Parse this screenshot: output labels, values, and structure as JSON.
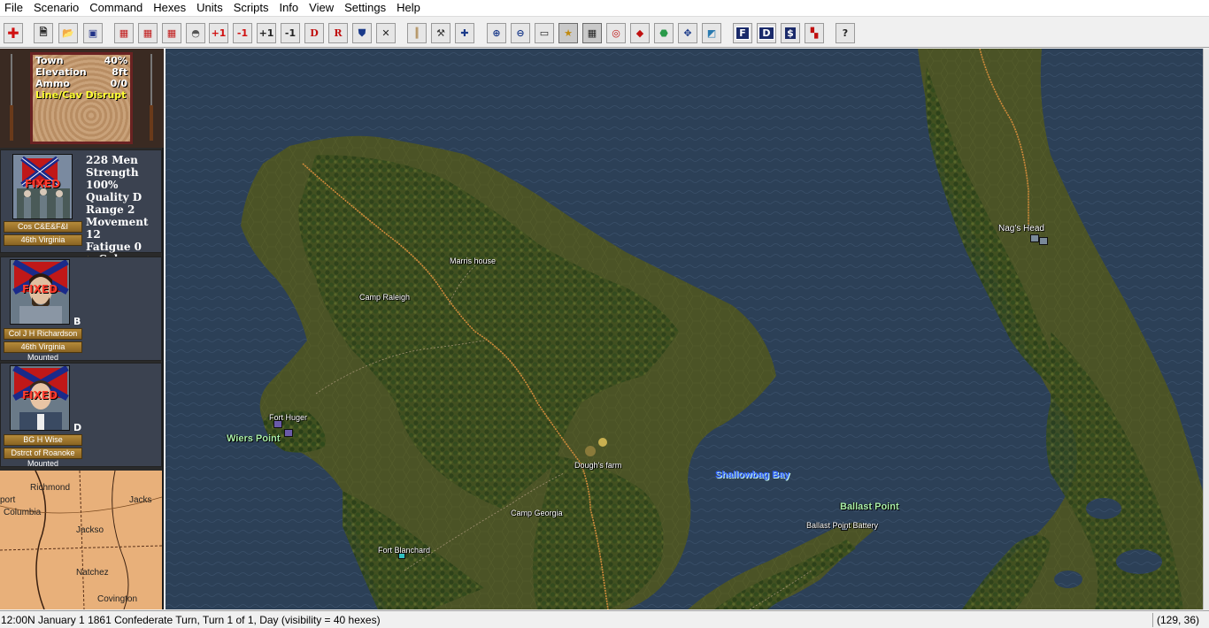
{
  "menu": [
    "File",
    "Scenario",
    "Command",
    "Hexes",
    "Units",
    "Scripts",
    "Info",
    "View",
    "Settings",
    "Help"
  ],
  "toolbar": {
    "plus1": "+1",
    "minus1": "-1",
    "plus1b": "+1",
    "minus1b": "-1",
    "d": "D",
    "r": "R",
    "help": "?",
    "f_box": "F",
    "d_box": "D"
  },
  "terrain": {
    "rows": [
      {
        "label": "Town",
        "value": "40%"
      },
      {
        "label": "Elevation",
        "value": "8ft"
      },
      {
        "label": "Ammo",
        "value": "0/0"
      }
    ],
    "effect": "Line/Cav Disrupt"
  },
  "unit": {
    "fixed": "FIXED",
    "men": "228 Men",
    "strength": "Strength 100%",
    "quality": "Quality D",
    "range": "Range 2",
    "movement": "Movement 12",
    "fatigue": "Fatigue 0",
    "formation": "Column",
    "name": "Cos C&E&F&I",
    "parent": "46th Virginia"
  },
  "leader1": {
    "fixed": "FIXED",
    "name": "Col J H Richardson",
    "command": "46th Virginia",
    "status": "Mounted",
    "grade": "B"
  },
  "leader2": {
    "fixed": "FIXED",
    "name": "BG H Wise",
    "command": "Dstrct of Roanoke",
    "status": "Mounted",
    "grade": "D"
  },
  "minimap": {
    "labels": [
      "Richmond",
      "Natchez",
      "Covington",
      "Columbia",
      "Jackso",
      "Jacks",
      "port"
    ]
  },
  "map": {
    "labels": {
      "marris_house": "Marris house",
      "camp_raleigh": "Camp Raleigh",
      "fort_huger": "Fort Huger",
      "wiers_point": "Wiers Point",
      "doughs_farm": "Dough's farm",
      "camp_georgia": "Camp Georgia",
      "fort_blanchard": "Fort Blanchard",
      "shallowbag_bay": "Shallowbag Bay",
      "ballast_point": "Ballast Point",
      "ballast_point_battery": "Ballast Point Battery",
      "nags_head": "Nag's Head"
    },
    "colors": {
      "water": "#2c4057",
      "land": "#4b5326",
      "forest": "#2f4a1c",
      "road": "#d08a3a"
    }
  },
  "status": {
    "text": "12:00N  January 1 1861 Confederate Turn, Turn 1 of 1, Day (visibility = 40 hexes)",
    "coords": "(129, 36)"
  }
}
